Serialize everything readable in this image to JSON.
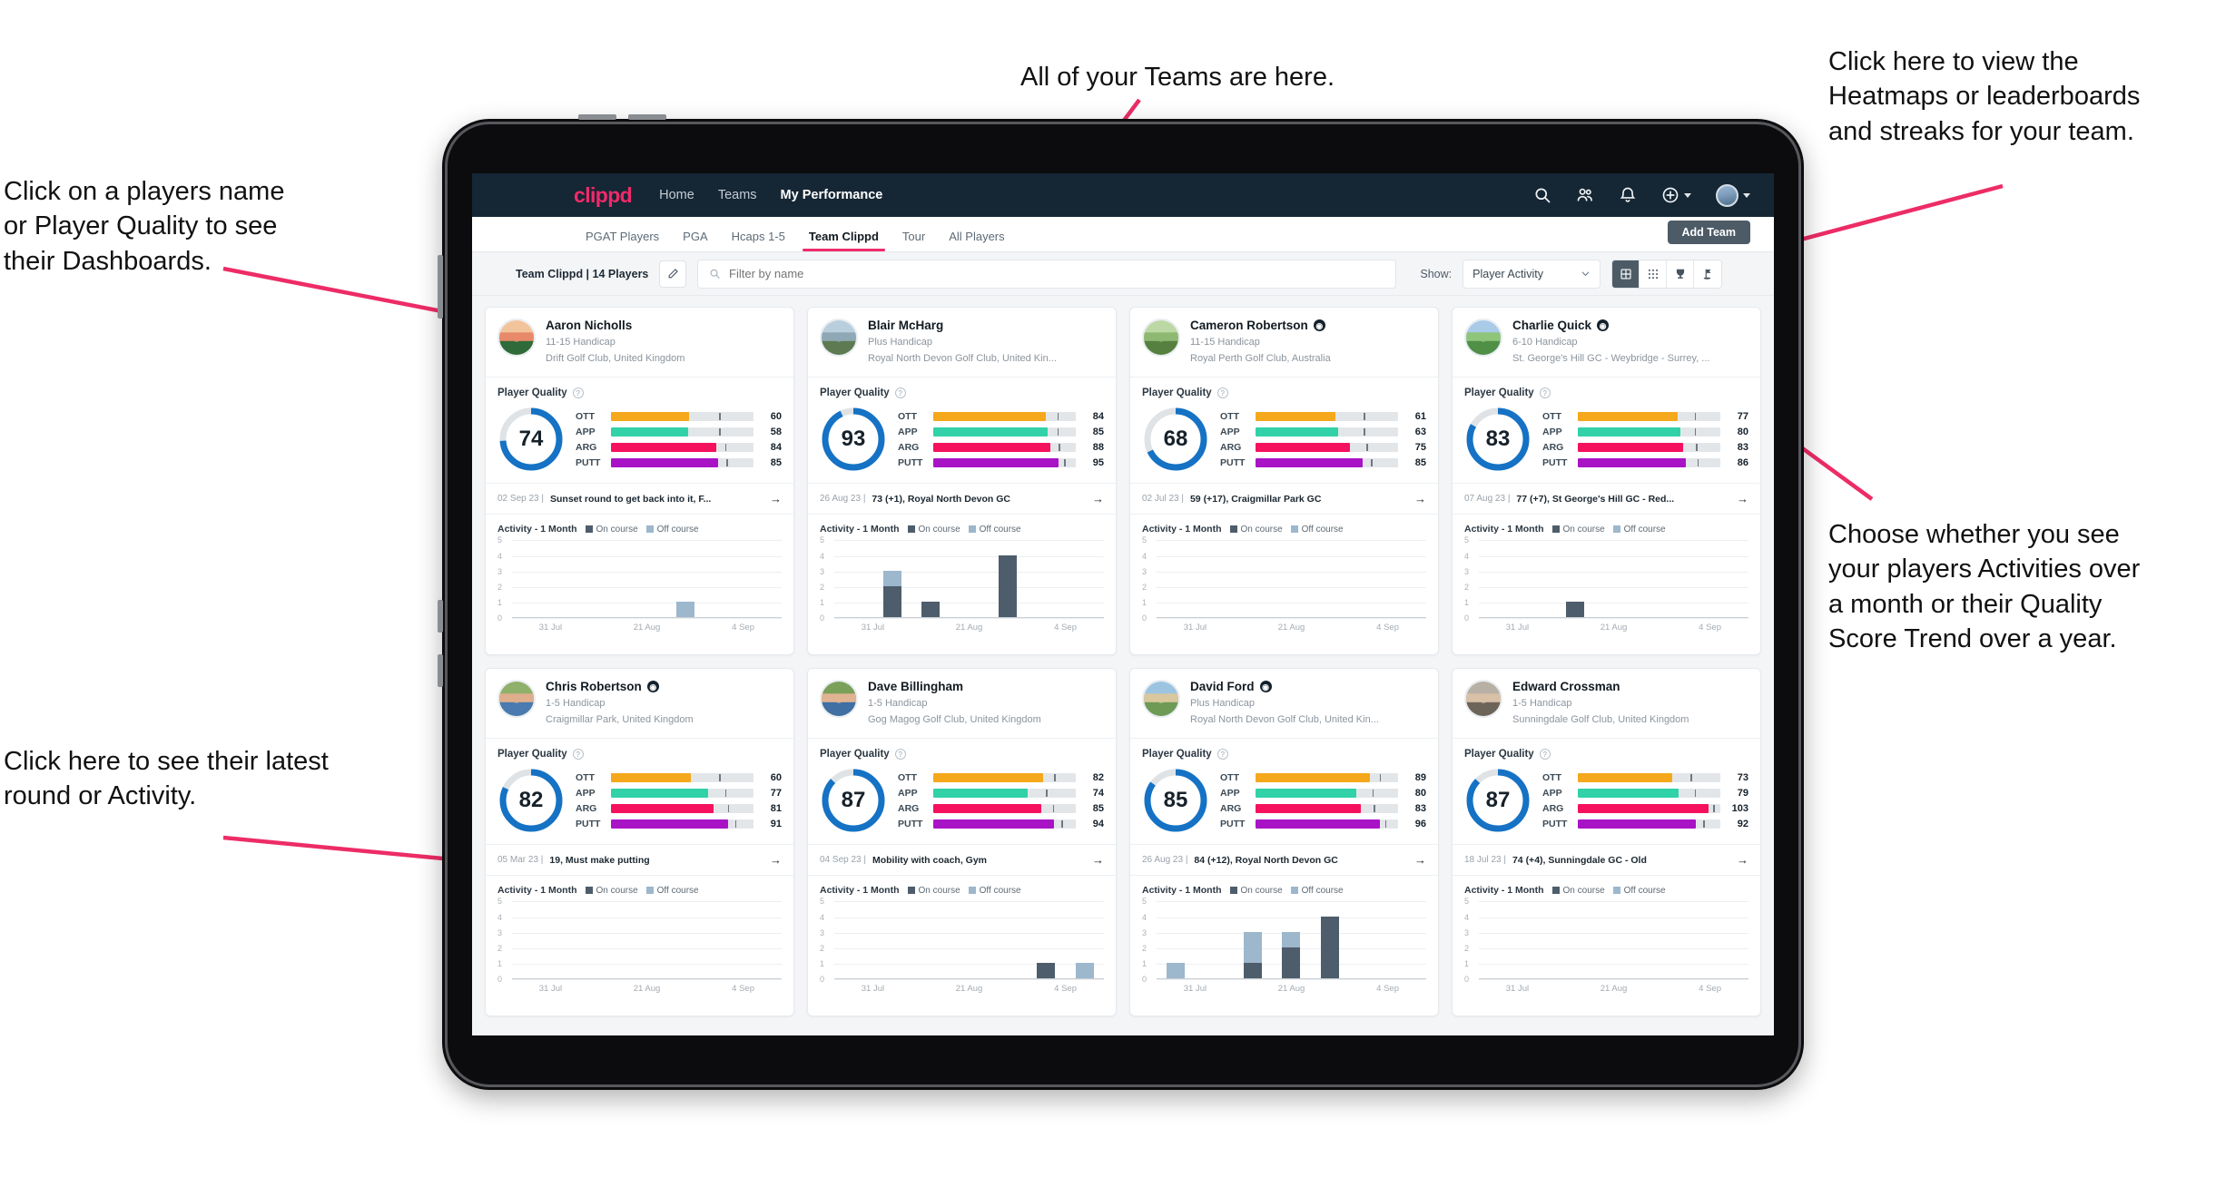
{
  "annotations": [
    {
      "id": "teams",
      "text": "All of your Teams are here."
    },
    {
      "id": "heatmaps",
      "text": "Click here to view the\nHeatmaps or leaderboards\nand streaks for your team."
    },
    {
      "id": "dashboards",
      "text": "Click on a players name\nor Player Quality to see\ntheir Dashboards."
    },
    {
      "id": "activity-toggle",
      "text": "Choose whether you see\nyour players Activities over\na month or their Quality\nScore Trend over a year."
    },
    {
      "id": "latest-round",
      "text": "Click here to see their latest\nround or Activity."
    }
  ],
  "app": {
    "brand": "clippd",
    "nav_links": [
      {
        "label": "Home",
        "active": false
      },
      {
        "label": "Teams",
        "active": false
      },
      {
        "label": "My Performance",
        "active": true
      }
    ],
    "nav_icons": [
      "search-icon",
      "people-icon",
      "bell-icon",
      "plus-circle-icon",
      "avatar"
    ],
    "subtabs": [
      {
        "label": "PGAT Players",
        "active": false
      },
      {
        "label": "PGA",
        "active": false
      },
      {
        "label": "Hcaps 1-5",
        "active": false
      },
      {
        "label": "Team Clippd",
        "active": true
      },
      {
        "label": "Tour",
        "active": false
      },
      {
        "label": "All Players",
        "active": false
      }
    ],
    "add_team_label": "Add Team",
    "toolbar": {
      "team_label": "Team Clippd | 14 Players",
      "edit_icon": "pencil-icon",
      "search_placeholder": "Filter by name",
      "search_value": "",
      "show_label": "Show:",
      "show_value": "Player Activity",
      "view_toggles": [
        {
          "name": "grid-view",
          "active": true
        },
        {
          "name": "dots-grid-view",
          "active": false
        },
        {
          "name": "trophy-view",
          "active": false
        },
        {
          "name": "flag-view",
          "active": false
        }
      ]
    },
    "card_labels": {
      "player_quality": "Player Quality",
      "activity": "Activity - 1 Month",
      "legend_on": "On course",
      "legend_off": "Off course"
    },
    "colors": {
      "brand": "#ef2a6a",
      "topnav": "#152634",
      "ring": "#1572c4",
      "ott": "#f5a81c",
      "app": "#31d2a8",
      "arg": "#f5115e",
      "putt": "#a913c6",
      "on_course": "#4e5d6b",
      "off_course": "#9db7cc"
    }
  },
  "chart_data": {
    "type": "bar",
    "title": "Activity - 1 Month",
    "ylabel": "",
    "ylim": [
      0,
      5
    ],
    "yticks": [
      0,
      1,
      2,
      3,
      4,
      5
    ],
    "xticks": [
      "31 Jul",
      "21 Aug",
      "4 Sep"
    ],
    "legend": [
      "On course",
      "Off course"
    ],
    "legend_position": "top",
    "grid": true,
    "per_player": [
      {
        "player": "Aaron Nicholls",
        "on_course": [
          0,
          0,
          0,
          0,
          0,
          0,
          0
        ],
        "off_course": [
          0,
          0,
          0,
          0,
          1,
          0,
          0
        ]
      },
      {
        "player": "Blair McHarg",
        "on_course": [
          0,
          2,
          1,
          0,
          4,
          0,
          0
        ],
        "off_course": [
          0,
          1,
          0,
          0,
          0,
          0,
          0
        ]
      },
      {
        "player": "Cameron Robertson",
        "on_course": [
          0,
          0,
          0,
          0,
          0,
          0,
          0
        ],
        "off_course": [
          0,
          0,
          0,
          0,
          0,
          0,
          0
        ]
      },
      {
        "player": "Charlie Quick",
        "on_course": [
          0,
          0,
          1,
          0,
          0,
          0,
          0
        ],
        "off_course": [
          0,
          0,
          0,
          0,
          0,
          0,
          0
        ]
      },
      {
        "player": "Chris Robertson",
        "on_course": [
          0,
          0,
          0,
          0,
          0,
          0,
          0
        ],
        "off_course": [
          0,
          0,
          0,
          0,
          0,
          0,
          0
        ]
      },
      {
        "player": "Dave Billingham",
        "on_course": [
          0,
          0,
          0,
          0,
          0,
          1,
          0
        ],
        "off_course": [
          0,
          0,
          0,
          0,
          0,
          0,
          1
        ]
      },
      {
        "player": "David Ford",
        "on_course": [
          0,
          0,
          1,
          2,
          4,
          0,
          0
        ],
        "off_course": [
          1,
          0,
          2,
          1,
          0,
          0,
          0
        ]
      },
      {
        "player": "Edward Crossman",
        "on_course": [
          0,
          0,
          0,
          0,
          0,
          0,
          0
        ],
        "off_course": [
          0,
          0,
          0,
          0,
          0,
          0,
          0
        ]
      }
    ]
  },
  "players": [
    {
      "name": "Aaron Nicholls",
      "verified": false,
      "handicap": "11-15 Handicap",
      "club": "Drift Golf Club, United Kingdom",
      "quality": 74,
      "metrics": [
        {
          "label": "OTT",
          "value": 60,
          "fill": 55,
          "tick": 76
        },
        {
          "label": "APP",
          "value": 58,
          "fill": 54,
          "tick": 76
        },
        {
          "label": "ARG",
          "value": 84,
          "fill": 74,
          "tick": 80
        },
        {
          "label": "PUTT",
          "value": 85,
          "fill": 75,
          "tick": 81
        }
      ],
      "latest_date": "02 Sep 23",
      "latest_text": "Sunset round to get back into it, F...",
      "avatar": "sunset-course"
    },
    {
      "name": "Blair McHarg",
      "verified": false,
      "handicap": "Plus Handicap",
      "club": "Royal North Devon Golf Club, United Kin...",
      "quality": 93,
      "metrics": [
        {
          "label": "OTT",
          "value": 84,
          "fill": 79,
          "tick": 87
        },
        {
          "label": "APP",
          "value": 85,
          "fill": 80,
          "tick": 87
        },
        {
          "label": "ARG",
          "value": 88,
          "fill": 82,
          "tick": 88
        },
        {
          "label": "PUTT",
          "value": 95,
          "fill": 88,
          "tick": 92
        }
      ],
      "latest_date": "26 Aug 23",
      "latest_text": "73 (+1), Royal North Devon GC",
      "avatar": "links"
    },
    {
      "name": "Cameron Robertson",
      "verified": true,
      "handicap": "11-15 Handicap",
      "club": "Royal Perth Golf Club, Australia",
      "quality": 68,
      "metrics": [
        {
          "label": "OTT",
          "value": 61,
          "fill": 56,
          "tick": 76
        },
        {
          "label": "APP",
          "value": 63,
          "fill": 58,
          "tick": 76
        },
        {
          "label": "ARG",
          "value": 75,
          "fill": 66,
          "tick": 78
        },
        {
          "label": "PUTT",
          "value": 85,
          "fill": 75,
          "tick": 81
        }
      ],
      "latest_date": "02 Jul 23",
      "latest_text": "59 (+17), Craigmillar Park GC",
      "avatar": "fairway"
    },
    {
      "name": "Charlie Quick",
      "verified": true,
      "handicap": "6-10 Handicap",
      "club": "St. George's Hill GC - Weybridge - Surrey, ...",
      "quality": 83,
      "metrics": [
        {
          "label": "OTT",
          "value": 77,
          "fill": 70,
          "tick": 82
        },
        {
          "label": "APP",
          "value": 80,
          "fill": 72,
          "tick": 82
        },
        {
          "label": "ARG",
          "value": 83,
          "fill": 74,
          "tick": 83
        },
        {
          "label": "PUTT",
          "value": 86,
          "fill": 76,
          "tick": 84
        }
      ],
      "latest_date": "07 Aug 23",
      "latest_text": "77 (+7), St George's Hill GC - Red...",
      "avatar": "green"
    },
    {
      "name": "Chris Robertson",
      "verified": true,
      "handicap": "1-5 Handicap",
      "club": "Craigmillar Park, United Kingdom",
      "quality": 82,
      "metrics": [
        {
          "label": "OTT",
          "value": 60,
          "fill": 56,
          "tick": 76
        },
        {
          "label": "APP",
          "value": 77,
          "fill": 68,
          "tick": 80
        },
        {
          "label": "ARG",
          "value": 81,
          "fill": 72,
          "tick": 82
        },
        {
          "label": "PUTT",
          "value": 91,
          "fill": 82,
          "tick": 87
        }
      ],
      "latest_date": "05 Mar 23",
      "latest_text": "19, Must make putting",
      "avatar": "portrait-a"
    },
    {
      "name": "Dave Billingham",
      "verified": false,
      "handicap": "1-5 Handicap",
      "club": "Gog Magog Golf Club, United Kingdom",
      "quality": 87,
      "metrics": [
        {
          "label": "OTT",
          "value": 82,
          "fill": 77,
          "tick": 85
        },
        {
          "label": "APP",
          "value": 74,
          "fill": 66,
          "tick": 79
        },
        {
          "label": "ARG",
          "value": 85,
          "fill": 76,
          "tick": 84
        },
        {
          "label": "PUTT",
          "value": 94,
          "fill": 85,
          "tick": 90
        }
      ],
      "latest_date": "04 Sep 23",
      "latest_text": "Mobility with coach, Gym",
      "avatar": "portrait-b"
    },
    {
      "name": "David Ford",
      "verified": true,
      "handicap": "Plus Handicap",
      "club": "Royal North Devon Golf Club, United Kin...",
      "quality": 85,
      "metrics": [
        {
          "label": "OTT",
          "value": 89,
          "fill": 80,
          "tick": 87
        },
        {
          "label": "APP",
          "value": 80,
          "fill": 71,
          "tick": 82
        },
        {
          "label": "ARG",
          "value": 83,
          "fill": 74,
          "tick": 83
        },
        {
          "label": "PUTT",
          "value": 96,
          "fill": 87,
          "tick": 91
        }
      ],
      "latest_date": "26 Aug 23",
      "latest_text": "84 (+12), Royal North Devon GC",
      "avatar": "beach"
    },
    {
      "name": "Edward Crossman",
      "verified": false,
      "handicap": "1-5 Handicap",
      "club": "Sunningdale Golf Club, United Kingdom",
      "quality": 87,
      "metrics": [
        {
          "label": "OTT",
          "value": 73,
          "fill": 66,
          "tick": 79
        },
        {
          "label": "APP",
          "value": 79,
          "fill": 71,
          "tick": 82
        },
        {
          "label": "ARG",
          "value": 103,
          "fill": 92,
          "tick": 95
        },
        {
          "label": "PUTT",
          "value": 92,
          "fill": 83,
          "tick": 88
        }
      ],
      "latest_date": "18 Jul 23",
      "latest_text": "74 (+4), Sunningdale GC - Old",
      "avatar": "portrait-c"
    }
  ]
}
